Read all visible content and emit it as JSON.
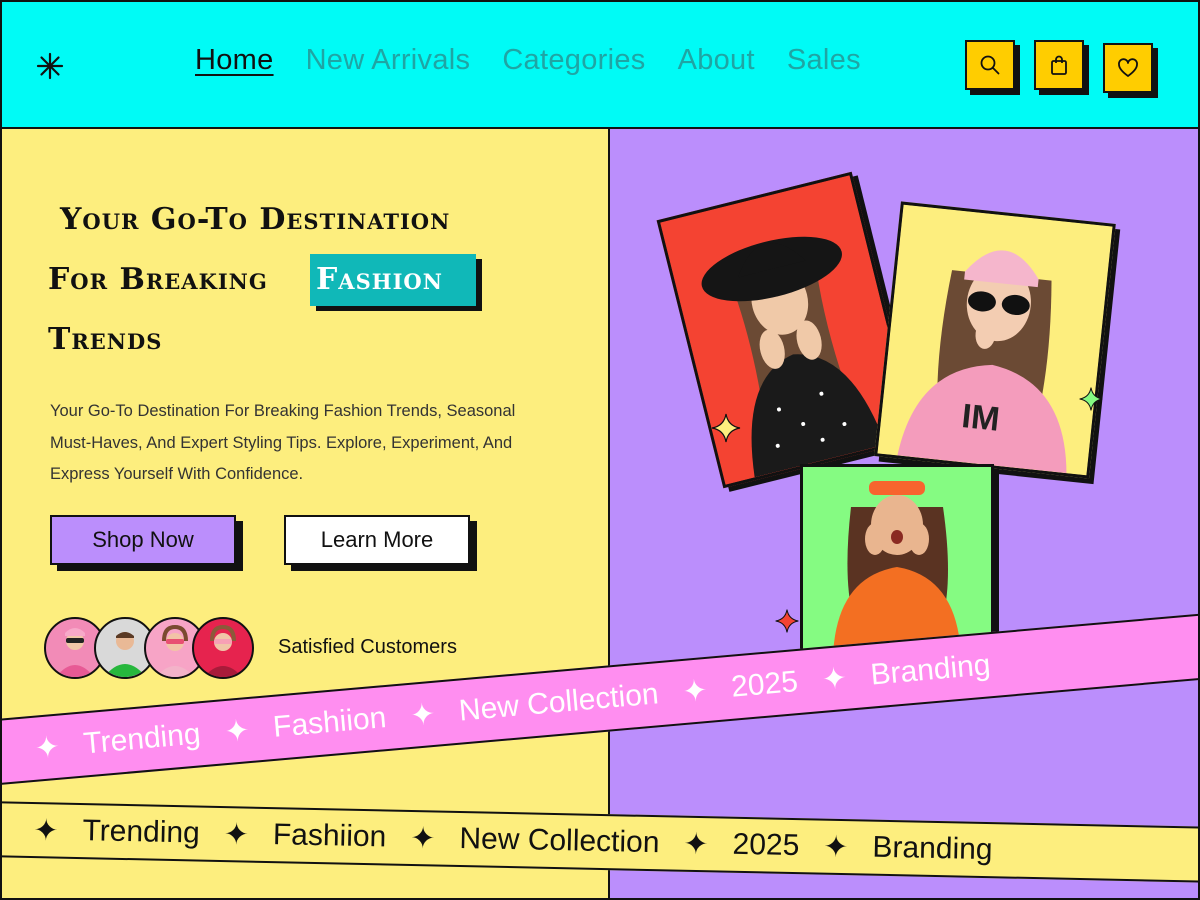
{
  "nav": {
    "logo_icon": "asterisk-logo-icon",
    "links": [
      "Home",
      "New Arrivals",
      "Categories",
      "About",
      "Sales"
    ],
    "active": "Home",
    "icons": [
      "search-icon",
      "shopping-bag-icon",
      "heart-icon"
    ]
  },
  "hero": {
    "headline_line1": "Your Go-To Destination",
    "headline_line2": "For Breaking",
    "headline_highlight": "Fashion",
    "headline_line3": "Trends",
    "description": "Your Go-To Destination For Breaking Fashion Trends, Seasonal Must-Haves, And Expert Styling Tips. Explore, Experiment, And Express Yourself With Confidence.",
    "shop_label": "Shop Now",
    "learn_label": "Learn More",
    "customers_label": "Satisfied Customers"
  },
  "ribbons": {
    "pink": [
      "Trending",
      "Fashiion",
      "New Collection",
      "2025",
      "Branding"
    ],
    "yellow": [
      "Trending",
      "Fashiion",
      "New Collection",
      "2025",
      "Branding"
    ]
  },
  "colors": {
    "header_bg": "#00fbf6",
    "hero_left_bg": "#fdee7e",
    "hero_right_bg": "#bb8efc",
    "accent_teal": "#10b8b8",
    "ribbon_pink": "#ff8ef0",
    "icon_button_bg": "#ffcd00"
  }
}
